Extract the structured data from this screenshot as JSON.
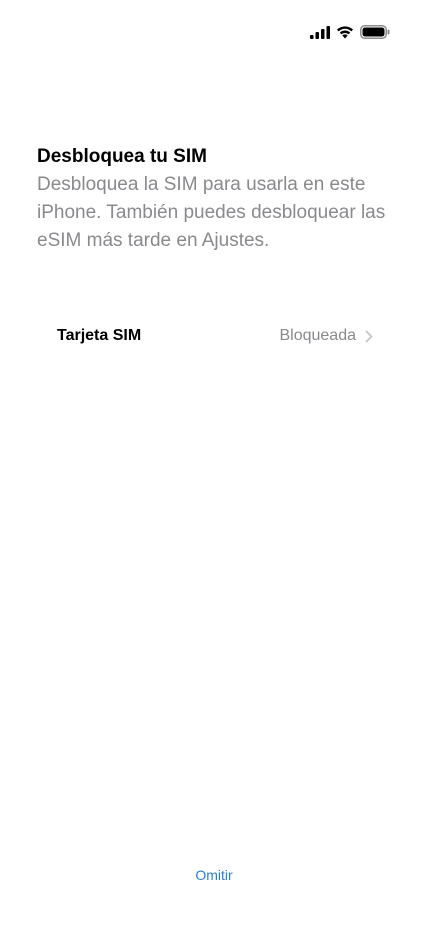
{
  "status_bar": {
    "icons": [
      "cellular-signal-icon",
      "wifi-icon",
      "battery-icon"
    ]
  },
  "header": {
    "title": "Desbloquea tu SIM",
    "subtitle": "Desbloquea la SIM para usarla en este iPhone. También puedes desbloquear las eSIM más tarde en Ajustes."
  },
  "sim_row": {
    "label": "Tarjeta SIM",
    "status": "Bloqueada",
    "icon": "chevron-right-icon"
  },
  "footer": {
    "skip_label": "Omitir"
  },
  "colors": {
    "accent": "#2a7fd4",
    "secondary_text": "#8a8a8e",
    "background": "#ffffff"
  }
}
